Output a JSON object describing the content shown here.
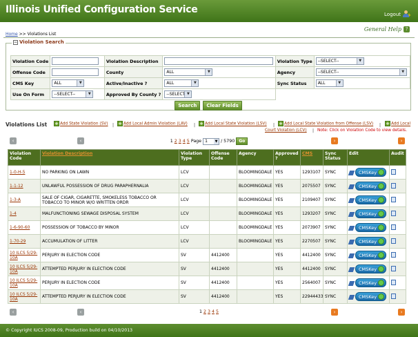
{
  "app": {
    "title": "Illinois Unified Configuration Service",
    "logout": "Logout",
    "general_help": "General Help",
    "help_icon_glyph": "?"
  },
  "breadcrumb": {
    "home": "Home",
    "sep": ">>",
    "current": "Violations List"
  },
  "search": {
    "legend": "Violation Search",
    "violation_code_label": "Violation Code",
    "violation_code_value": "",
    "violation_description_label": "Violation Description",
    "violation_description_value": "",
    "violation_type_label": "Violation Type",
    "violation_type_value": "--SELECT--",
    "offense_code_label": "Offense Code",
    "offense_code_value": "",
    "county_label": "County",
    "county_value": "ALL",
    "agency_label": "Agency",
    "agency_value": "--SELECT--",
    "cms_key_label": "CMS Key",
    "cms_key_value": "ALL",
    "active_inactive_label": "Active/Inactive ?",
    "active_inactive_value": "ALL",
    "sync_status_label": "Sync Status",
    "sync_status_value": "ALL",
    "use_on_form_label": "Use On Form",
    "use_on_form_value": "--SELECT--",
    "approved_by_county_label": "Approved By County ?",
    "approved_by_county_value": "--SELECT--",
    "search_button": "Search",
    "clear_button": "Clear Fields"
  },
  "violations": {
    "title": "Violations List",
    "add_sv": "Add State Violation (SV)",
    "add_lav": "Add Local Admin Violation (LAV)",
    "add_lsv": "Add Local State Violation (LSV)",
    "add_lsv_offense": "Add Local State Violation from Offense (LSV)",
    "add_lcv_1": "Add Local",
    "add_lcv_2": "Court Violation (LCV)",
    "separator": "|",
    "note": "Note: Click on Violation Code to view details."
  },
  "pager": {
    "pages": [
      "1",
      "2",
      "3",
      "4",
      "5"
    ],
    "page_label": "Page",
    "page_value": "1",
    "total": "/ 5790",
    "go": "Go",
    "prev_icon": "‹",
    "next_icon": "›"
  },
  "table": {
    "headers": {
      "code": "Violation Code",
      "desc": "Violation Description",
      "type": "Violation Type",
      "offense": "Offense Code",
      "agency": "Agency",
      "approved": "Approved ?",
      "cms": "CMS",
      "sync": "Sync Status",
      "edit": "Edit",
      "audit": "Audit"
    },
    "rows": [
      {
        "code": "1-0-H-5",
        "desc": "NO PARKING ON LAWN",
        "type": "LCV",
        "offense": "",
        "agency": "BLOOMINGDALE",
        "approved": "YES",
        "cms": "1293107",
        "sync": "SYNC"
      },
      {
        "code": "1-1-12",
        "desc": "UNLAWFUL POSSESSION OF DRUG PARAPHERNALIA",
        "type": "LCV",
        "offense": "",
        "agency": "BLOOMINGDALE",
        "approved": "YES",
        "cms": "2075507",
        "sync": "SYNC"
      },
      {
        "code": "1-3-A",
        "desc": "SALE OF CIGAR, CIGARETTE, SMOKELESS TOBACCO OR TOBACCO TO MINOR W/O WRITTEN ORDR",
        "type": "LCV",
        "offense": "",
        "agency": "BLOOMINGDALE",
        "approved": "YES",
        "cms": "2109407",
        "sync": "SYNC"
      },
      {
        "code": "1-4",
        "desc": "MALFUNCTIONING SEWAGE DISPOSAL SYSTEM",
        "type": "LCV",
        "offense": "",
        "agency": "BLOOMINGDALE",
        "approved": "YES",
        "cms": "1293207",
        "sync": "SYNC"
      },
      {
        "code": "1-6-90-60",
        "desc": "POSSESSION OF TOBACCO BY MINOR",
        "type": "LCV",
        "offense": "",
        "agency": "BLOOMINGDALE",
        "approved": "YES",
        "cms": "2073907",
        "sync": "SYNC"
      },
      {
        "code": "1-70-29",
        "desc": "ACCUMULATION OF LITTER",
        "type": "LCV",
        "offense": "",
        "agency": "BLOOMINGDALE",
        "approved": "YES",
        "cms": "2270507",
        "sync": "SYNC"
      },
      {
        "code": "10 ILCS 5/29-10A",
        "desc": "PERJURY IN ELECTION CODE",
        "type": "SV",
        "offense": "4412400",
        "agency": "",
        "approved": "YES",
        "cms": "4412400",
        "sync": "SYNC"
      },
      {
        "code": "10 ILCS 5/29-10A",
        "desc": "ATTEMPTED PERJURY IN ELECTION CODE",
        "type": "SV",
        "offense": "4412400",
        "agency": "",
        "approved": "YES",
        "cms": "4412400",
        "sync": "SYNC"
      },
      {
        "code": "10 ILCS 5/29-10A",
        "desc": "PERJURY IN ELECTION CODE",
        "type": "SV",
        "offense": "4412400",
        "agency": "",
        "approved": "YES",
        "cms": "2564007",
        "sync": "SYNC"
      },
      {
        "code": "10 ILCS 5/29-10A",
        "desc": "ATTEMPTED PERJURY IN ELECTION CODE",
        "type": "SV",
        "offense": "4412400",
        "agency": "",
        "approved": "YES",
        "cms": "22944433",
        "sync": "SYNC"
      }
    ],
    "cms_button": "CMSKey"
  },
  "footer": {
    "text": "© Copyright IUCS 2008-09, Production build on 04/10/2013"
  }
}
